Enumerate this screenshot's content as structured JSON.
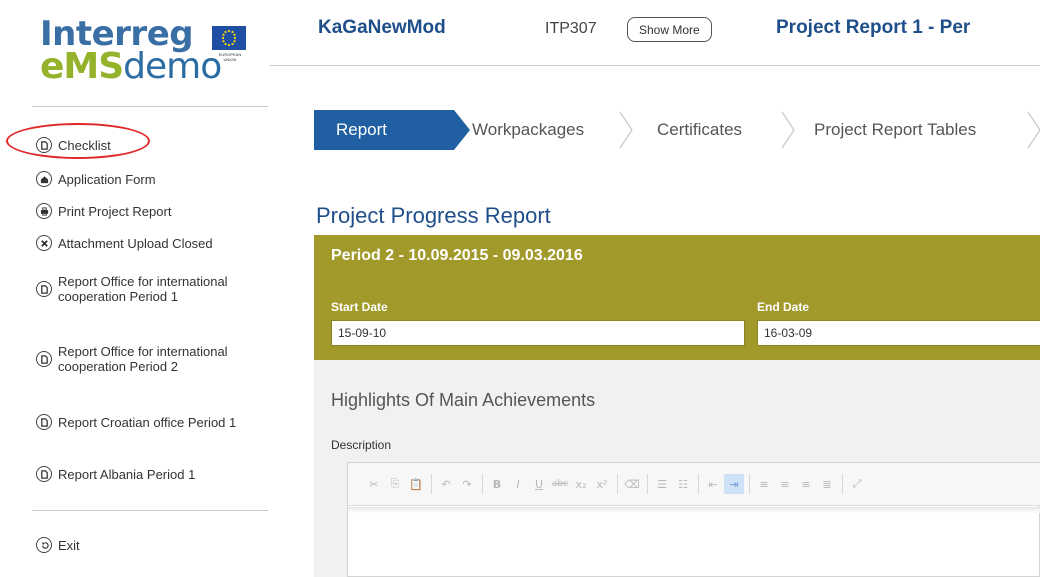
{
  "logo": {
    "top_text": "Interreg",
    "bottom_ems": "eMS",
    "bottom_demo": "demo",
    "eu_caption": "EUROPEAN UNION"
  },
  "sidebar": {
    "items": [
      {
        "label": "Checklist",
        "icon": "document-icon"
      },
      {
        "label": "Application Form",
        "icon": "home-icon"
      },
      {
        "label": "Print Project Report",
        "icon": "print-icon"
      },
      {
        "label": "Attachment Upload Closed",
        "icon": "close-icon"
      },
      {
        "label": "Report Office for international cooperation Period 1",
        "icon": "document-icon"
      },
      {
        "label": "Report Office for international cooperation Period 2",
        "icon": "document-icon"
      },
      {
        "label": "Report Croatian office Period 1",
        "icon": "document-icon"
      },
      {
        "label": "Report Albania Period 1",
        "icon": "document-icon"
      }
    ],
    "exit_label": "Exit"
  },
  "header": {
    "project_acronym": "KaGaNewMod",
    "project_code": "ITP307",
    "show_more_label": "Show More",
    "report_title": "Project Report 1 - Per"
  },
  "steps": [
    {
      "label": "Report",
      "active": true
    },
    {
      "label": "Workpackages",
      "active": false
    },
    {
      "label": "Certificates",
      "active": false
    },
    {
      "label": "Project Report Tables",
      "active": false
    }
  ],
  "main": {
    "section_title": "Project Progress Report",
    "period_title": "Period 2 - 10.09.2015 - 09.03.2016",
    "start_date_label": "Start Date",
    "start_date_value": "15-09-10",
    "end_date_label": "End Date",
    "end_date_value": "16-03-09",
    "highlights_title": "Highlights Of Main Achievements",
    "description_label": "Description"
  },
  "colors": {
    "brand_blue": "#1f5fa2",
    "period_olive": "#a19a2b",
    "highlight_red": "#e02828",
    "logo_green": "#94b22a"
  }
}
